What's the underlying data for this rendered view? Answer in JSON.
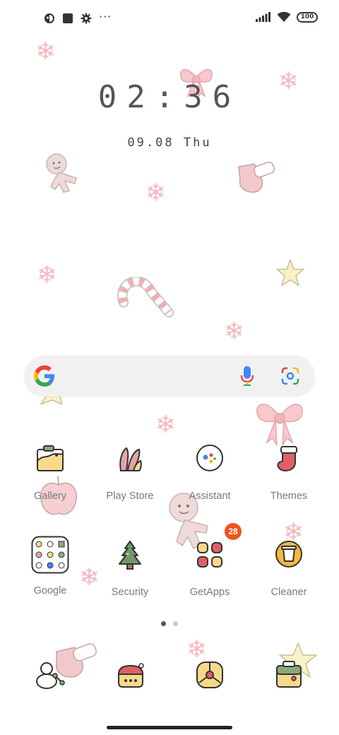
{
  "status_bar": {
    "left_icons": [
      "notification-app-icon",
      "square-notification-icon",
      "gear-icon"
    ],
    "more": "···",
    "battery": "100",
    "signal": "signal-bars-icon",
    "wifi": "wifi-icon"
  },
  "clock": {
    "time": "02:36",
    "date": "09.08 Thu"
  },
  "search": {
    "logo": "google-g-icon",
    "mic": "mic-icon",
    "lens": "lens-icon",
    "colors": {
      "blue": "#4285F4",
      "red": "#EA4335",
      "yellow": "#FBBC05",
      "green": "#34A853"
    }
  },
  "apps": [
    {
      "label": "Gallery",
      "icon": "gallery-icon"
    },
    {
      "label": "Play Store",
      "icon": "play-store-icon"
    },
    {
      "label": "Assistant",
      "icon": "assistant-icon"
    },
    {
      "label": "Themes",
      "icon": "themes-stocking-icon"
    },
    {
      "label": "Google",
      "icon": "google-folder-icon"
    },
    {
      "label": "Security",
      "icon": "security-tree-icon"
    },
    {
      "label": "GetApps",
      "icon": "getapps-icon",
      "badge": "28"
    },
    {
      "label": "Cleaner",
      "icon": "cleaner-icon"
    }
  ],
  "pages": {
    "count": 2,
    "active": 1
  },
  "dock": [
    {
      "icon": "phone-snowman-icon"
    },
    {
      "icon": "messages-icon"
    },
    {
      "icon": "browser-icon"
    },
    {
      "icon": "camera-icon"
    }
  ],
  "theme_colors": {
    "snow": "#f2b8bd",
    "pink": "#f0c4c6",
    "badge": "#f0541e"
  }
}
